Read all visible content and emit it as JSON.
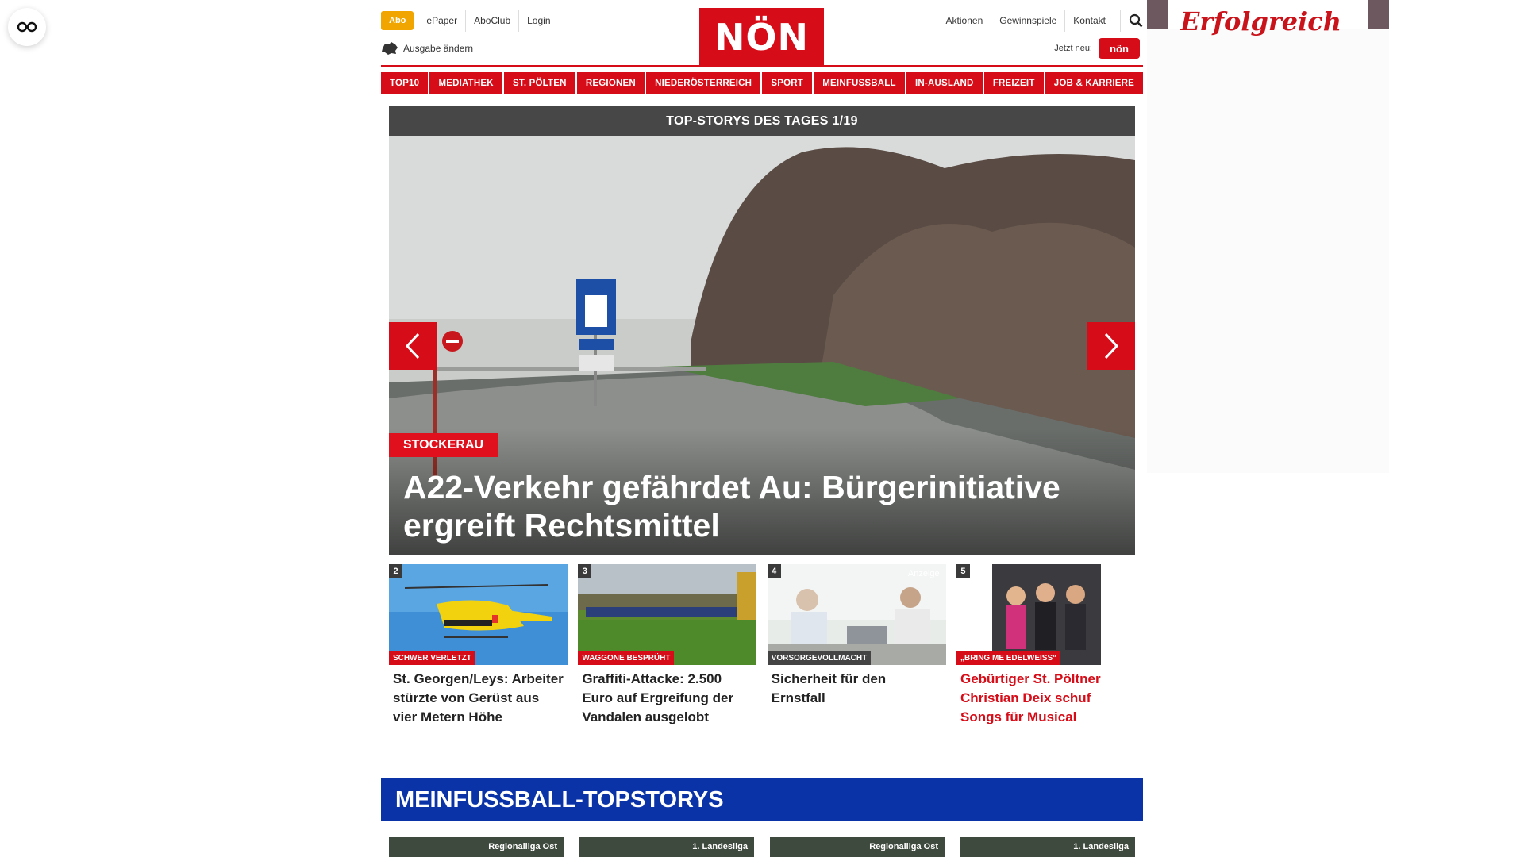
{
  "header": {
    "abo_label": "Abo",
    "links_left": [
      "ePaper",
      "AboClub",
      "Login"
    ],
    "ausgabe_label": "Ausgabe ändern",
    "logo_text": "NÖN",
    "links_right": [
      "Aktionen",
      "Gewinnspiele",
      "Kontakt"
    ],
    "jetzt_label": "Jetzt neu:",
    "badge_text": "nön"
  },
  "nav": [
    "TOP10",
    "MEDIATHEK",
    "ST. PÖLTEN",
    "REGIONEN",
    "NIEDERÖSTERREICH",
    "SPORT",
    "MEINFUSSBALL",
    "IN-AUSLAND",
    "FREIZEIT",
    "JOB & KARRIERE"
  ],
  "top_stories": {
    "heading": "TOP-STORYS DES TAGES 1/19",
    "hero_category": "STOCKERAU",
    "hero_title": "A22-Verkehr gefährdet Au: Bürgerinitiative ergreift Rechtsmittel"
  },
  "cards": [
    {
      "num": "2",
      "category": "SCHWER VERLETZT",
      "title": "St. Georgen/Leys: Arbeiter stürzte von Gerüst aus vier Metern Höhe"
    },
    {
      "num": "3",
      "category": "WAGGONE BESPRÜHT",
      "title": "Graffiti-Attacke: 2.500 Euro auf Ergreifung der Vandalen ausgelobt"
    },
    {
      "num": "4",
      "category": "VORSORGEVOLLMACHT",
      "title": "Sicherheit für den Ernstfall",
      "badge": "Anzeige"
    },
    {
      "num": "5",
      "category": "„BRING ME EDELWEISS“",
      "title": "Gebürtiger St. Pöltner Christian Deix schuf Songs für Musical"
    }
  ],
  "meinfussball": {
    "heading": "MEINFUSSBALL-TOPSTORYS",
    "leagues": [
      "Regionalliga Ost",
      "1. Landesliga",
      "Regionalliga Ost",
      "1. Landesliga"
    ]
  },
  "ad": {
    "text": "Erfolgreich"
  },
  "colors": {
    "brand_red": "#d60d18",
    "abo_orange": "#f0a500",
    "mf_blue": "#0a33a8",
    "ts_header": "#474747"
  }
}
